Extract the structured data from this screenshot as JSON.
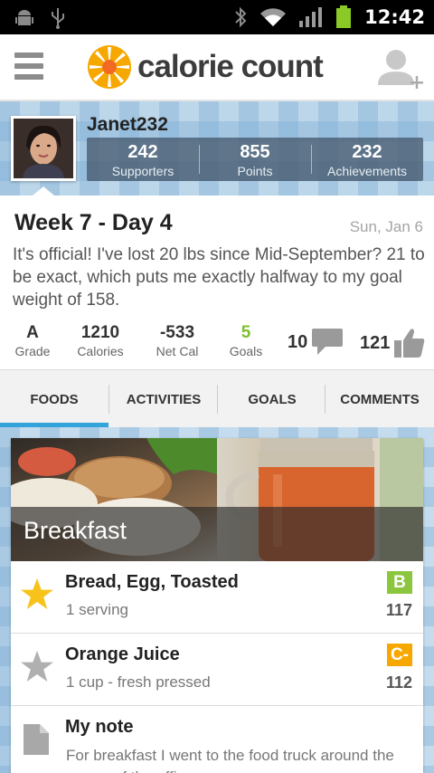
{
  "status_bar": {
    "time": "12:42",
    "icons": [
      "android-debug-icon",
      "usb-icon",
      "bluetooth-icon",
      "wifi-icon",
      "signal-icon",
      "battery-icon"
    ]
  },
  "app_bar": {
    "brand": "calorie count",
    "icons": [
      "menu-icon",
      "add-user-icon"
    ]
  },
  "profile": {
    "username": "Janet232",
    "stats": [
      {
        "value": "242",
        "label": "Supporters"
      },
      {
        "value": "855",
        "label": "Points"
      },
      {
        "value": "232",
        "label": "Achievements"
      }
    ]
  },
  "post": {
    "title": "Week 7 - Day 4",
    "date": "Sun, Jan 6",
    "body": "It's official! I've lost 20 lbs since Mid-September? 21 to be exact, which puts me exactly halfway to my goal weight of 158.",
    "metrics": [
      {
        "value": "A",
        "label": "Grade"
      },
      {
        "value": "1210",
        "label": "Calories"
      },
      {
        "value": "-533",
        "label": "Net Cal"
      },
      {
        "value": "5",
        "label": "Goals"
      }
    ],
    "comments_count": "10",
    "likes_count": "121"
  },
  "tabs": [
    {
      "label": "FOODS",
      "active": true
    },
    {
      "label": "ACTIVITIES",
      "active": false
    },
    {
      "label": "GOALS",
      "active": false
    },
    {
      "label": "COMMENTS",
      "active": false
    }
  ],
  "meal": {
    "title": "Breakfast",
    "items": [
      {
        "name": "Bread, Egg, Toasted",
        "detail": "1 serving",
        "grade": "B",
        "grade_color": "#8cc63f",
        "calories": "117",
        "starred": true
      },
      {
        "name": "Orange Juice",
        "detail": "1 cup - fresh pressed",
        "grade": "C-",
        "grade_color": "#f7a800",
        "calories": "112",
        "starred": false
      }
    ],
    "note": {
      "title": "My note",
      "text": "For breakfast I went to the food truck around the corner of the office"
    }
  },
  "colors": {
    "accent_blue": "#33a3dc",
    "goals_green": "#7cc22d",
    "star_gold": "#f7c31a",
    "star_gray": "#b0b0b0"
  }
}
